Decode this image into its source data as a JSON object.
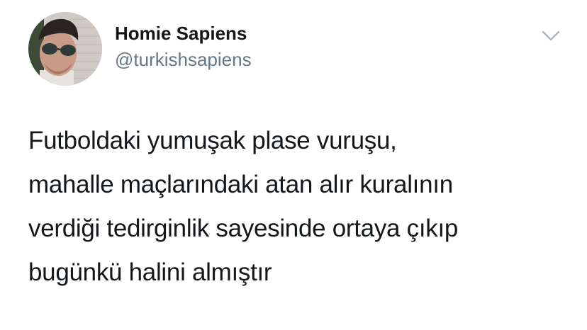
{
  "author": {
    "display_name": "Homie Sapiens",
    "handle": "@turkishsapiens",
    "avatar_icon": "profile-photo",
    "menu_icon": "chevron-down-icon"
  },
  "tweet": {
    "lines": [
      "Futboldaki yumuşak plase vuruşu,",
      "mahalle maçlarındaki atan alır kuralının",
      "verdiği tedirginlik sayesinde ortaya çıkıp",
      "bugünkü halini almıştır"
    ]
  },
  "colors": {
    "name": "#14171a",
    "handle": "#657786",
    "text": "#14171a",
    "chevron": "#aab8c2",
    "background": "#ffffff"
  }
}
